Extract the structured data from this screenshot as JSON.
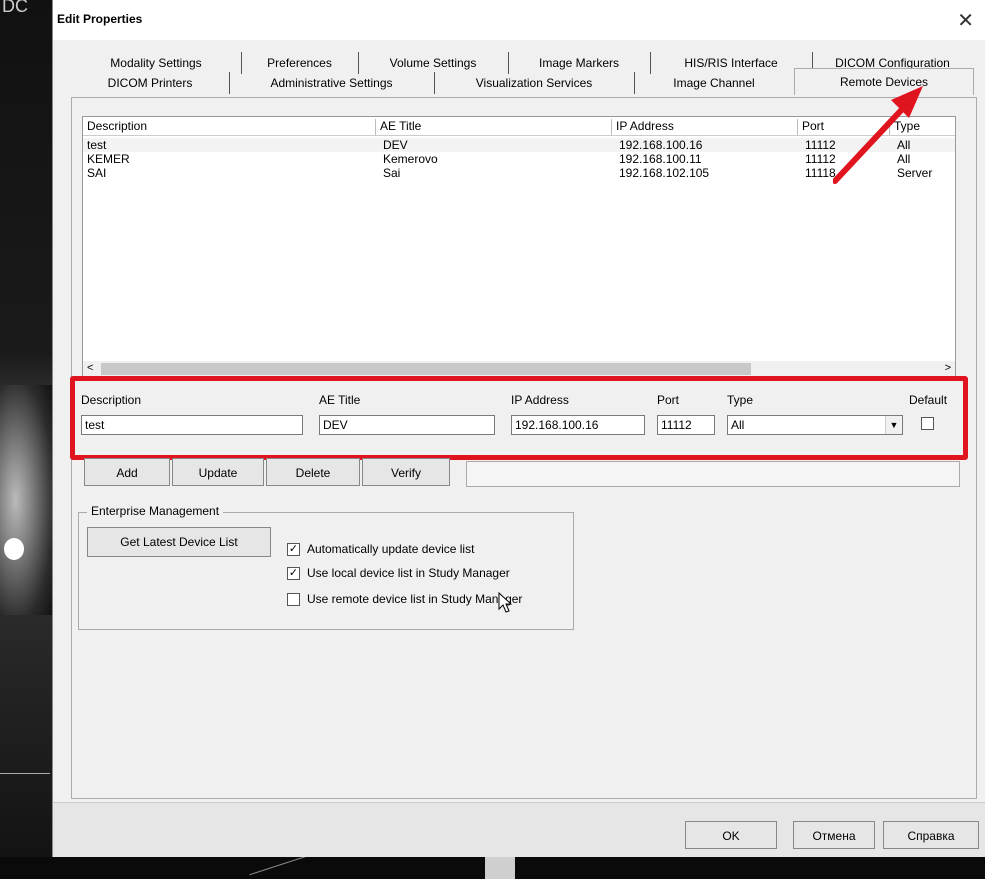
{
  "background": {
    "left_label": "DC"
  },
  "window": {
    "title": "Edit Properties",
    "close_glyph": "✕"
  },
  "tabs_row1": [
    "Modality Settings",
    "Preferences",
    "Volume Settings",
    "Image Markers",
    "HIS/RIS Interface",
    "DICOM Configuration"
  ],
  "tabs_row2": [
    "DICOM Printers",
    "Administrative Settings",
    "Visualization Services",
    "Image Channel",
    "Remote Devices"
  ],
  "active_tab": "Remote Devices",
  "list": {
    "headers": [
      "Description",
      "AE Title",
      "IP Address",
      "Port",
      "Type"
    ],
    "rows": [
      [
        "test",
        "DEV",
        "192.168.100.16",
        "11112",
        "All"
      ],
      [
        "KEMER",
        "Kemerovo",
        "192.168.100.11",
        "11112",
        "All"
      ],
      [
        "SAI",
        "Sai",
        "192.168.102.105",
        "11118",
        "Server"
      ]
    ],
    "scroll_left": "<",
    "scroll_right": ">"
  },
  "editor": {
    "description_label": "Description",
    "description_value": "test",
    "ae_title_label": "AE Title",
    "ae_title_value": "DEV",
    "ip_label": "IP Address",
    "ip_value": "192.168.100.16",
    "port_label": "Port",
    "port_value": "11112",
    "type_label": "Type",
    "type_value": "All",
    "default_label": "Default"
  },
  "actions": {
    "add": "Add",
    "update": "Update",
    "delete": "Delete",
    "verify": "Verify"
  },
  "enterprise": {
    "title": "Enterprise Management",
    "get_latest": "Get Latest Device List",
    "options": [
      {
        "label": "Automatically update device list",
        "checked": true
      },
      {
        "label": "Use local device list in Study Manager",
        "checked": true
      },
      {
        "label": "Use remote device list in Study Manager",
        "checked": false
      }
    ]
  },
  "footer": {
    "ok": "OK",
    "cancel": "Отмена",
    "help": "Справка"
  },
  "colors": {
    "highlight_border": "#e0141e",
    "arrow": "#e0141e"
  },
  "icons": {
    "close": "close-icon",
    "dropdown": "chevron-down-icon",
    "cursor": "cursor-icon",
    "annotation": "arrow-annotation-icon"
  }
}
